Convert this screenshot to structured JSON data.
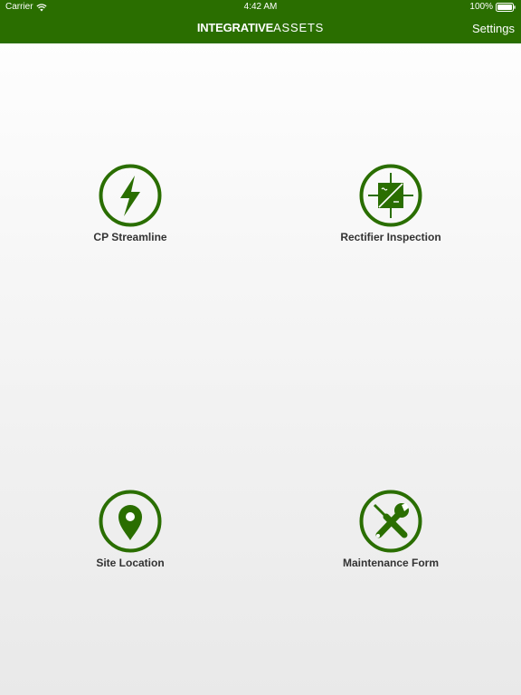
{
  "status_bar": {
    "carrier": "Carrier",
    "time": "4:42 AM",
    "battery": "100%",
    "icons": [
      "wifi-icon",
      "battery-icon"
    ]
  },
  "nav": {
    "brand_bold": "INTEGRATIVE",
    "brand_light": "ASSETS",
    "settings_label": "Settings"
  },
  "tiles": [
    {
      "label": "CP Streamline",
      "icon": "lightning-bolt-icon"
    },
    {
      "label": "Rectifier Inspection",
      "icon": "rectifier-icon"
    },
    {
      "label": "Site Location",
      "icon": "map-pin-icon"
    },
    {
      "label": "Maintenance Form",
      "icon": "wrench-screwdriver-icon"
    }
  ],
  "colors": {
    "brand_green": "#2a6e00",
    "icon_green": "#2a6e00",
    "label_text": "#333333",
    "background_top": "#ffffff",
    "background_bottom": "#e9e9e9"
  }
}
